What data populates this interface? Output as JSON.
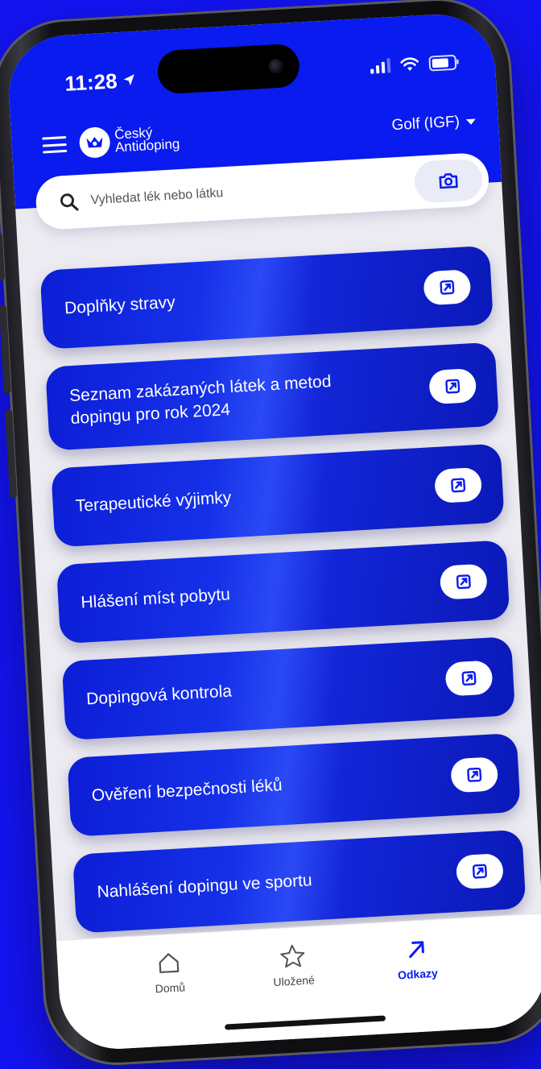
{
  "status_bar": {
    "time": "11:28"
  },
  "header": {
    "brand": {
      "line1": "Český",
      "line2": "Antidoping"
    },
    "sport_selector": "Golf (IGF)"
  },
  "search": {
    "placeholder": "Vyhledat lék nebo látku"
  },
  "links": [
    {
      "label": "Doplňky stravy"
    },
    {
      "label": "Seznam zakázaných látek a metod dopingu pro rok 2024"
    },
    {
      "label": "Terapeutické výjimky"
    },
    {
      "label": "Hlášení míst pobytu"
    },
    {
      "label": "Dopingová kontrola"
    },
    {
      "label": "Ověření bezpečnosti léků"
    },
    {
      "label": "Nahlášení dopingu ve sportu"
    }
  ],
  "tabs": [
    {
      "label": "Domů",
      "icon": "home-icon"
    },
    {
      "label": "Uložené",
      "icon": "star-icon"
    },
    {
      "label": "Odkazy",
      "icon": "arrow-up-right-icon",
      "active": true
    }
  ],
  "colors": {
    "background": "#1313f0",
    "header": "#0a1bf0",
    "accent": "#0a1bf0",
    "screen_bg": "#ecebf1"
  }
}
